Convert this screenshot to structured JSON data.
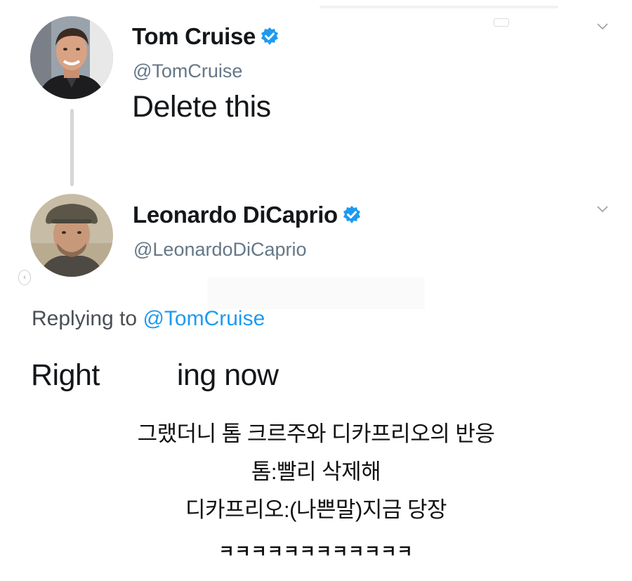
{
  "tweet1": {
    "name": "Tom Cruise",
    "handle": "@TomCruise",
    "text": "Delete this",
    "verified": true
  },
  "tweet2": {
    "name": "Leonardo DiCaprio",
    "handle": "@LeonardoDiCaprio",
    "verified": true,
    "replying_label": "Replying to",
    "replying_handle": "@TomCruise",
    "text_before": "Right",
    "text_after": "ing now"
  },
  "caption": {
    "line1": "그랬더니 톰 크르주와 디카프리오의 반응",
    "line2": "톰:빨리 삭제해",
    "line3": "디카프리오:(나쁜말)지금 당장",
    "laugh": "ㅋㅋㅋㅋㅋㅋㅋㅋㅋㅋㅋㅋ"
  },
  "icons": {
    "verified": "verified-badge-icon",
    "chevron": "chevron-down-icon",
    "colors": {
      "verified": "#1d9bf0",
      "muted": "#657786",
      "link": "#1d9bf0"
    }
  }
}
